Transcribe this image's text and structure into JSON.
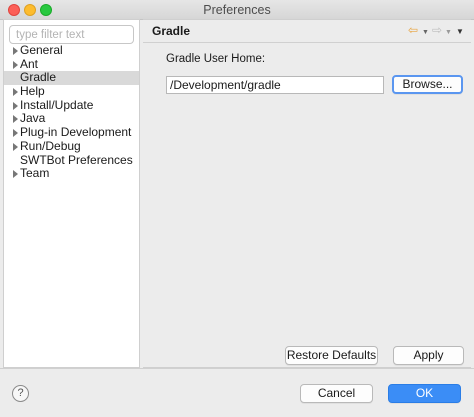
{
  "window": {
    "title": "Preferences"
  },
  "sidebar": {
    "filter_placeholder": "type filter text",
    "items": [
      {
        "label": "General",
        "expandable": true
      },
      {
        "label": "Ant",
        "expandable": true
      },
      {
        "label": "Gradle",
        "expandable": false,
        "selected": true
      },
      {
        "label": "Help",
        "expandable": true
      },
      {
        "label": "Install/Update",
        "expandable": true
      },
      {
        "label": "Java",
        "expandable": true
      },
      {
        "label": "Plug-in Development",
        "expandable": true
      },
      {
        "label": "Run/Debug",
        "expandable": true
      },
      {
        "label": "SWTBot Preferences",
        "expandable": false
      },
      {
        "label": "Team",
        "expandable": true
      }
    ]
  },
  "page": {
    "title": "Gradle",
    "field_label": "Gradle User Home:",
    "field_value": "/Development/gradle",
    "browse_label": "Browse...",
    "restore_label": "Restore Defaults",
    "apply_label": "Apply",
    "nav_icons": [
      "back-arrow-icon",
      "forward-arrow-icon",
      "view-menu-icon"
    ]
  },
  "footer": {
    "help_symbol": "?",
    "cancel_label": "Cancel",
    "ok_label": "OK"
  },
  "colors": {
    "accent": "#3b8df6",
    "selection": "#d9d9d9",
    "back_arrow": "#e8a33d"
  }
}
